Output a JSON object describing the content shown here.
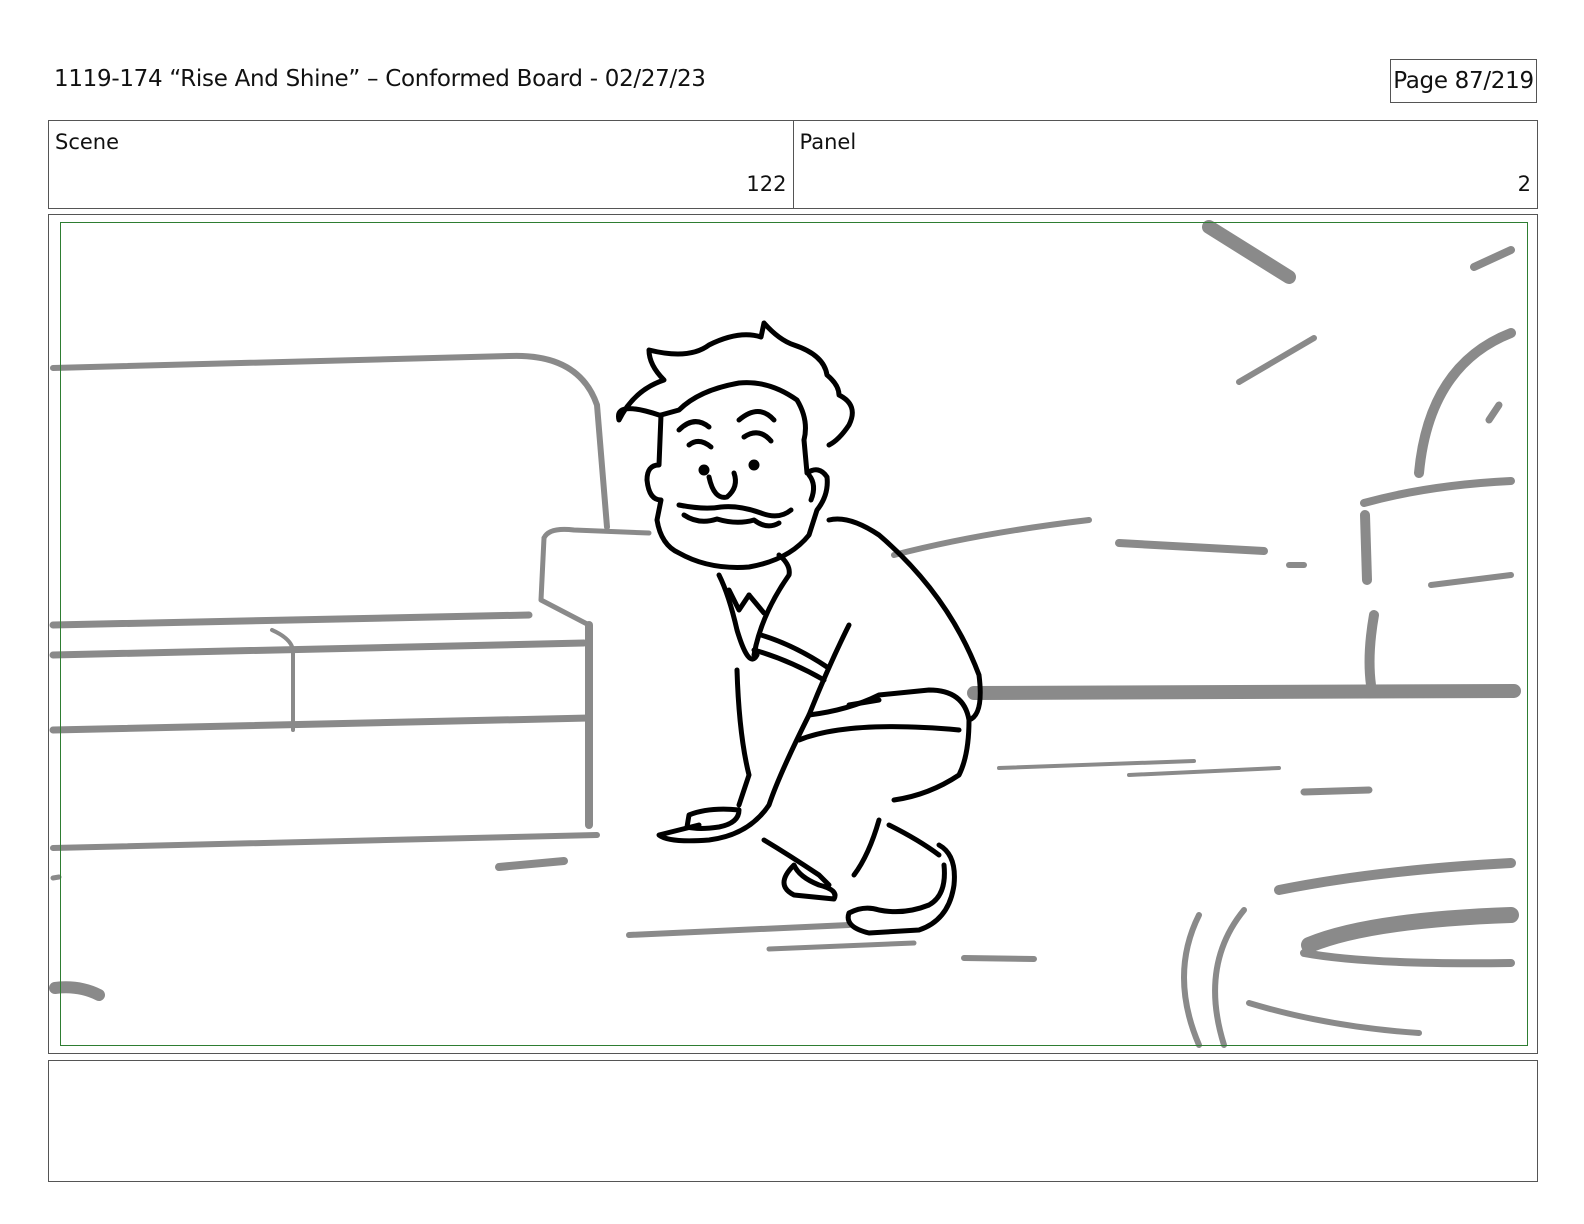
{
  "header": {
    "title": "1119-174 “Rise And Shine” – Conformed Board - 02/27/23",
    "page_label": "Page  87/219"
  },
  "info": {
    "scene_label": "Scene",
    "scene_number": "122",
    "panel_label": "Panel",
    "panel_number": "2"
  },
  "drawing": {
    "description_icon": "storyboard-sketch",
    "bg_line_color": "#8a8a8a",
    "character_line_color": "#000000",
    "safe_frame_color": "#2e7d32"
  },
  "notes": {
    "text": ""
  }
}
